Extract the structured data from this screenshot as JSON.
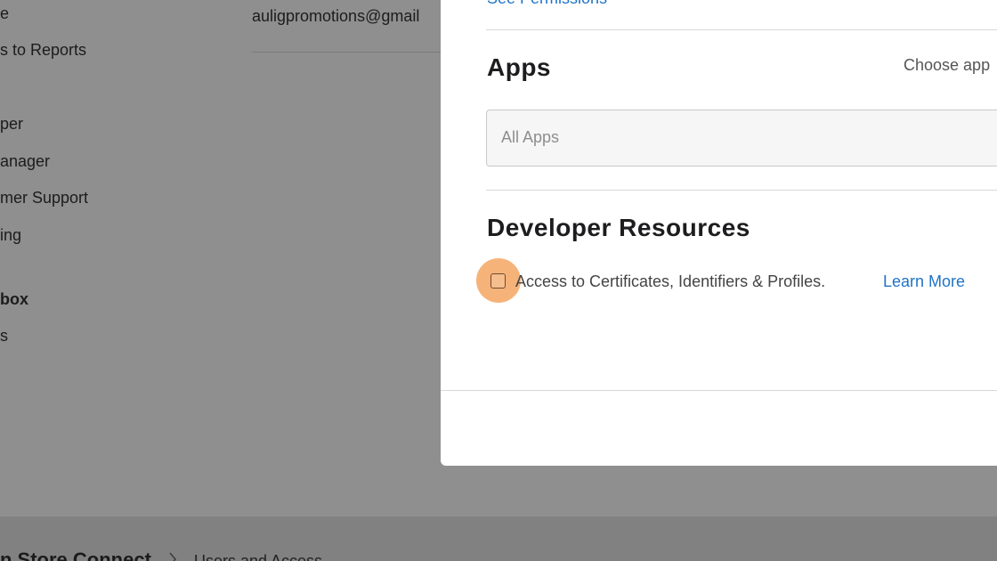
{
  "background": {
    "sidebar_items": [
      {
        "label": "e",
        "bold": false
      },
      {
        "label": "s to Reports",
        "bold": false
      },
      {
        "label": "per",
        "bold": false
      },
      {
        "label": "anager",
        "bold": false
      },
      {
        "label": "mer Support",
        "bold": false
      },
      {
        "label": "ing",
        "bold": false
      },
      {
        "label": "box",
        "bold": true
      },
      {
        "label": "s",
        "bold": false
      }
    ],
    "email": "auligpromotions@gmail",
    "footer": {
      "brand": "n Store Connect",
      "crumb": "Users and Access"
    }
  },
  "modal": {
    "see_permissions_link": "See Permissions",
    "apps_section": {
      "title": "Apps",
      "choose_label": "Choose app",
      "field_value": "All Apps"
    },
    "developer_resources": {
      "title": "Developer Resources",
      "checkbox_label": "Access to Certificates, Identifiers & Profiles.",
      "checkbox_checked": false,
      "learn_more": "Learn More"
    }
  },
  "colors": {
    "overlay_gray": "#8f8f8f",
    "link_blue": "#1f73c7",
    "highlight_orange": "#f5a662"
  }
}
